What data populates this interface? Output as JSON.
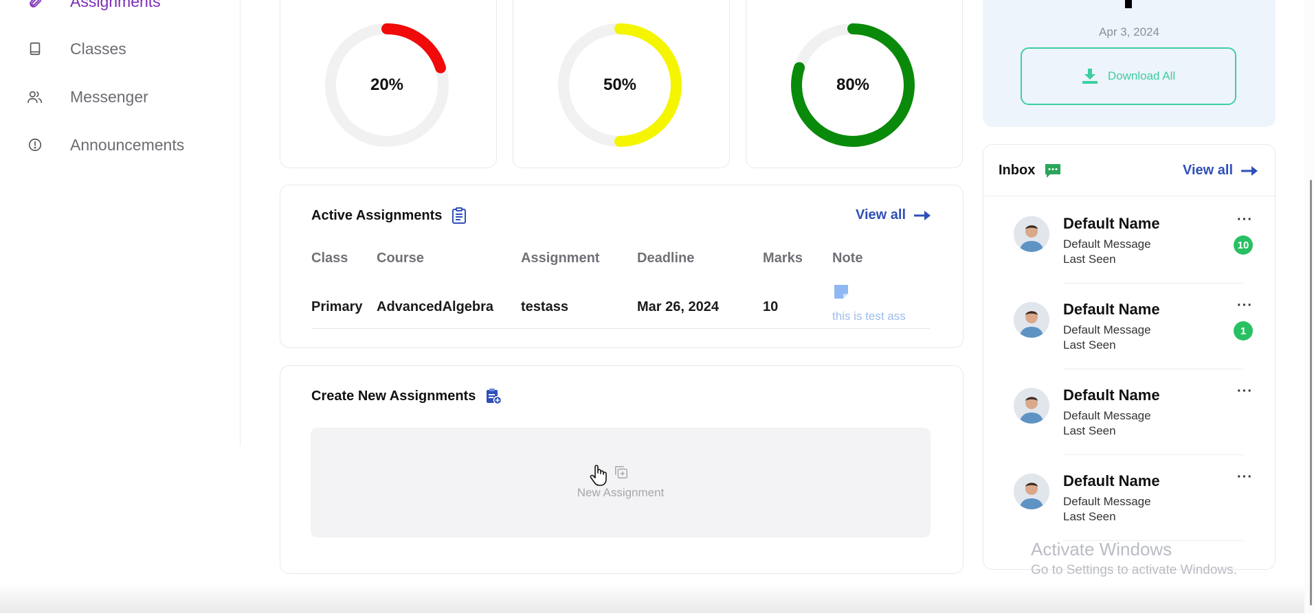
{
  "sidebar": {
    "items": [
      {
        "label": "Assignments",
        "icon": "paperclip-icon"
      },
      {
        "label": "Classes",
        "icon": "book-icon"
      },
      {
        "label": "Messenger",
        "icon": "users-icon"
      },
      {
        "label": "Announcements",
        "icon": "alert-circle-icon"
      }
    ]
  },
  "progress": [
    {
      "label": "20%",
      "value": 0.2,
      "color": "#f00a0a"
    },
    {
      "label": "50%",
      "value": 0.5,
      "color": "#f5f500"
    },
    {
      "label": "80%",
      "value": 0.8,
      "color": "#0a8a0a"
    }
  ],
  "active_assignments": {
    "title": "Active Assignments",
    "view_all": "View all",
    "columns": [
      "Class",
      "Course",
      "Assignment",
      "Deadline",
      "Marks",
      "Note"
    ],
    "rows": [
      {
        "class": "Primary",
        "course": "AdvancedAlgebra",
        "assignment": "testass",
        "deadline": "Mar 26, 2024",
        "marks": "10",
        "note": "this is test ass"
      }
    ]
  },
  "create": {
    "title": "Create New Assignments",
    "button": "New Assignment"
  },
  "download": {
    "date": "Apr 3, 2024",
    "button": "Download All"
  },
  "inbox": {
    "title": "Inbox",
    "view_all": "View all",
    "messages": [
      {
        "name": "Default Name",
        "message": "Default Message",
        "seen": "Last Seen",
        "badge": "10"
      },
      {
        "name": "Default Name",
        "message": "Default Message",
        "seen": "Last Seen",
        "badge": "1"
      },
      {
        "name": "Default Name",
        "message": "Default Message",
        "seen": "Last Seen",
        "badge": ""
      },
      {
        "name": "Default Name",
        "message": "Default Message",
        "seen": "Last Seen",
        "badge": ""
      }
    ],
    "more": "···"
  },
  "watermark": {
    "line1": "Activate Windows",
    "line2": "Go to Settings to activate Windows."
  },
  "colors": {
    "accent_purple": "#7b2bb5",
    "link_blue": "#2f4fb8",
    "download_green": "#3ccf9f",
    "badge_green": "#28c062"
  }
}
